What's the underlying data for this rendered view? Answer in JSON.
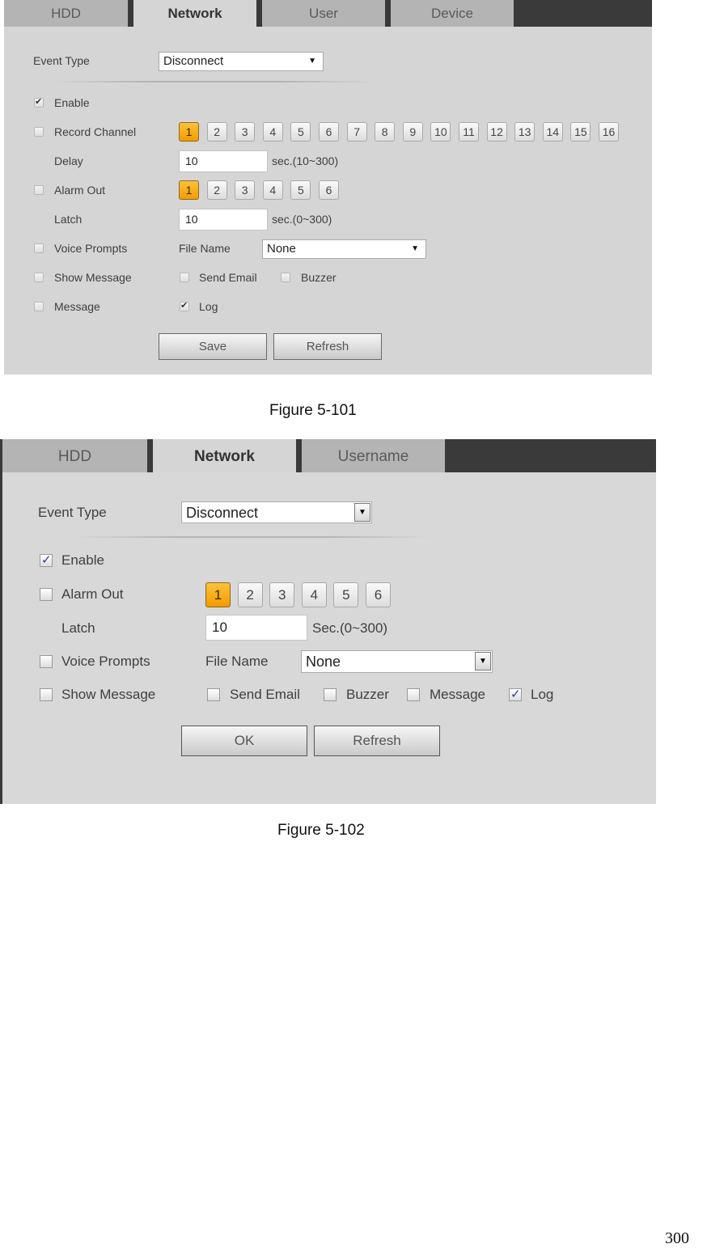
{
  "figure1": {
    "tabs": [
      {
        "label": "HDD",
        "active": false
      },
      {
        "label": "Network",
        "active": true
      },
      {
        "label": "User",
        "active": false
      },
      {
        "label": "Device",
        "active": false
      }
    ],
    "event_type": {
      "label": "Event Type",
      "value": "Disconnect"
    },
    "enable": {
      "label": "Enable",
      "checked": true
    },
    "record_channel": {
      "label": "Record Channel",
      "checked": false,
      "channels": [
        "1",
        "2",
        "3",
        "4",
        "5",
        "6",
        "7",
        "8",
        "9",
        "10",
        "11",
        "12",
        "13",
        "14",
        "15",
        "16"
      ],
      "selected": [
        "1"
      ]
    },
    "delay": {
      "label": "Delay",
      "value": "10",
      "unit": "sec.(10~300)"
    },
    "alarm_out": {
      "label": "Alarm Out",
      "checked": false,
      "outputs": [
        "1",
        "2",
        "3",
        "4",
        "5",
        "6"
      ],
      "selected": [
        "1"
      ]
    },
    "latch": {
      "label": "Latch",
      "value": "10",
      "unit": "sec.(0~300)"
    },
    "voice_prompts": {
      "label": "Voice Prompts",
      "checked": false,
      "file_name_label": "File Name",
      "file_name_value": "None"
    },
    "show_message": {
      "label": "Show Message",
      "checked": false
    },
    "send_email": {
      "label": "Send Email",
      "checked": false
    },
    "buzzer": {
      "label": "Buzzer",
      "checked": false
    },
    "message": {
      "label": "Message",
      "checked": false
    },
    "log": {
      "label": "Log",
      "checked": true
    },
    "buttons": {
      "save": "Save",
      "refresh": "Refresh"
    },
    "caption": "Figure 5-101"
  },
  "figure2": {
    "tabs": [
      {
        "label": "HDD",
        "active": false
      },
      {
        "label": "Network",
        "active": true
      },
      {
        "label": "Username",
        "active": false
      }
    ],
    "event_type": {
      "label": "Event Type",
      "value": "Disconnect"
    },
    "enable": {
      "label": "Enable",
      "checked": true
    },
    "alarm_out": {
      "label": "Alarm Out",
      "checked": false,
      "outputs": [
        "1",
        "2",
        "3",
        "4",
        "5",
        "6"
      ],
      "selected": [
        "1"
      ]
    },
    "latch": {
      "label": "Latch",
      "value": "10",
      "unit": "Sec.(0~300)"
    },
    "voice_prompts": {
      "label": "Voice Prompts",
      "checked": false,
      "file_name_label": "File Name",
      "file_name_value": "None"
    },
    "show_message": {
      "label": "Show Message",
      "checked": false
    },
    "send_email": {
      "label": "Send Email",
      "checked": false
    },
    "buzzer": {
      "label": "Buzzer",
      "checked": false
    },
    "message": {
      "label": "Message",
      "checked": false
    },
    "log": {
      "label": "Log",
      "checked": true
    },
    "buttons": {
      "ok": "OK",
      "refresh": "Refresh"
    },
    "caption": "Figure 5-102"
  },
  "page_number": "300"
}
